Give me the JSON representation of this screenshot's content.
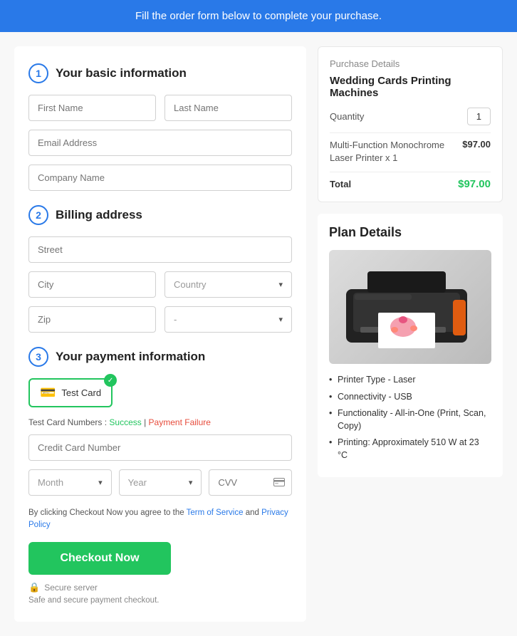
{
  "banner": {
    "text": "Fill the order form below to complete your purchase."
  },
  "left": {
    "section1": {
      "number": "1",
      "title": "Your basic information",
      "firstName": {
        "placeholder": "First Name"
      },
      "lastName": {
        "placeholder": "Last Name"
      },
      "email": {
        "placeholder": "Email Address"
      },
      "company": {
        "placeholder": "Company Name"
      }
    },
    "section2": {
      "number": "2",
      "title": "Billing address",
      "street": {
        "placeholder": "Street"
      },
      "city": {
        "placeholder": "City"
      },
      "country": {
        "placeholder": "Country"
      },
      "zip": {
        "placeholder": "Zip"
      },
      "statePlaceholder": "-"
    },
    "section3": {
      "number": "3",
      "title": "Your payment information",
      "testCardLabel": "Test Card",
      "testCardNote": "Test Card Numbers :",
      "successLink": "Success",
      "failureLink": "Payment Failure",
      "ccPlaceholder": "Credit Card Number",
      "monthPlaceholder": "Month",
      "yearPlaceholder": "Year",
      "cvvPlaceholder": "CVV"
    },
    "terms": {
      "prefix": "By clicking Checkout Now you agree to the ",
      "tosLabel": "Term of Service",
      "middle": " and ",
      "ppLabel": "Privacy Policy"
    },
    "checkoutBtn": "Checkout Now",
    "secureServer": "Secure server",
    "safeText": "Safe and secure payment checkout."
  },
  "right": {
    "purchase": {
      "sectionTitle": "Purchase Details",
      "productName": "Wedding Cards Printing Machines",
      "quantityLabel": "Quantity",
      "quantityValue": "1",
      "itemName": "Multi-Function Monochrome Laser Printer x 1",
      "itemPrice": "$97.00",
      "totalLabel": "Total",
      "totalPrice": "$97.00"
    },
    "plan": {
      "title": "Plan Details",
      "features": [
        "Printer Type - Laser",
        "Connectivity - USB",
        "Functionality - All-in-One (Print, Scan, Copy)",
        "Printing: Approximately 510 W at 23 °C"
      ]
    }
  }
}
